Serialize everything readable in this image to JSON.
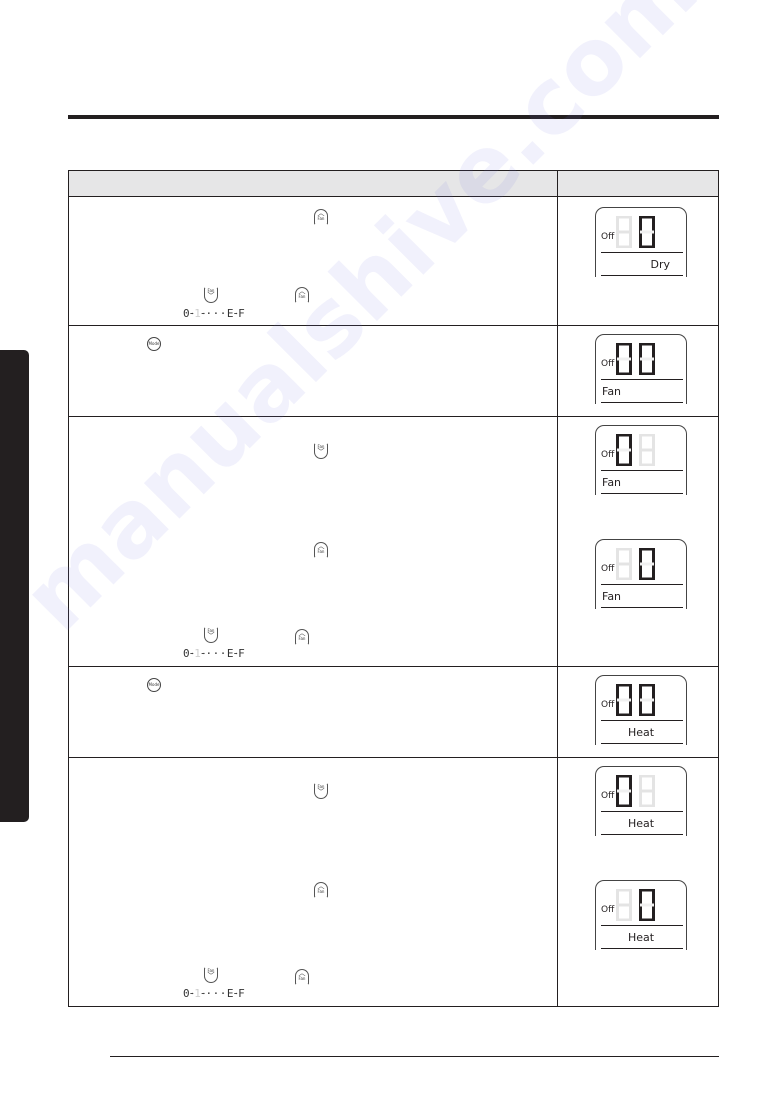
{
  "page": {
    "watermark": "manualshive.com"
  },
  "table": {
    "header": {
      "left": "",
      "right": ""
    },
    "sequence": {
      "start": "0",
      "second": "1",
      "ellipsis": "···",
      "penultimate": "E",
      "last": "F"
    },
    "icons": {
      "fan_label": "Fan",
      "mode_label": "Mode",
      "up_chevron": "︿",
      "down_chevron": "﹀"
    },
    "rows": [
      {
        "displays": [
          {
            "off_label": "Off",
            "digits": [
              "8",
              "0"
            ],
            "lit": [
              false,
              true
            ],
            "mode": "Dry"
          }
        ]
      },
      {
        "displays": [
          {
            "off_label": "Off",
            "digits": [
              "0",
              "0"
            ],
            "lit": [
              true,
              true
            ],
            "mode": "Fan"
          }
        ]
      },
      {
        "displays": [
          {
            "off_label": "Off",
            "digits": [
              "0",
              "8"
            ],
            "lit": [
              true,
              false
            ],
            "mode": "Fan"
          },
          {
            "off_label": "Off",
            "digits": [
              "8",
              "0"
            ],
            "lit": [
              false,
              true
            ],
            "mode": "Fan"
          }
        ]
      },
      {
        "displays": [
          {
            "off_label": "Off",
            "digits": [
              "0",
              "0"
            ],
            "lit": [
              true,
              true
            ],
            "mode": "Heat"
          }
        ]
      },
      {
        "displays": [
          {
            "off_label": "Off",
            "digits": [
              "0",
              "8"
            ],
            "lit": [
              true,
              false
            ],
            "mode": "Heat"
          },
          {
            "off_label": "Off",
            "digits": [
              "8",
              "0"
            ],
            "lit": [
              false,
              true
            ],
            "mode": "Heat"
          }
        ]
      }
    ]
  }
}
